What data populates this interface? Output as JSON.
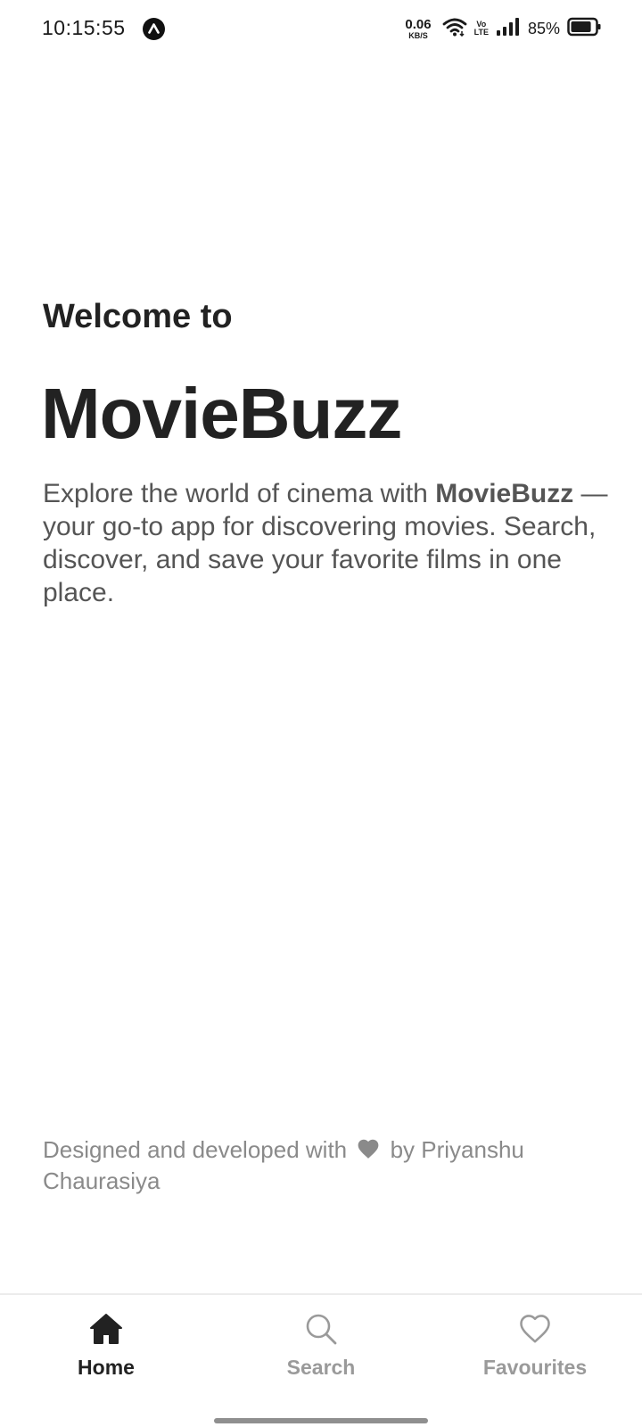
{
  "status_bar": {
    "time": "10:15:55",
    "net_speed_value": "0.06",
    "net_speed_unit": "KB/S",
    "volte_top": "Vo",
    "volte_bottom": "LTE",
    "battery_percent": "85%",
    "battery_level": 0.85,
    "icons": [
      "app-notification-icon",
      "wifi-icon",
      "volte-icon",
      "signal-icon",
      "battery-icon"
    ]
  },
  "hero": {
    "welcome": "Welcome to",
    "app_name": "MovieBuzz",
    "description_part1": "Explore the world of cinema with ",
    "description_bold": "MovieBuzz",
    "description_part2": " — your go-to app for discovering movies. Search, discover, and save your favorite films in one place."
  },
  "credit": {
    "prefix": "Designed and developed with",
    "suffix": "by Priyanshu Chaurasiya",
    "icon": "heart-icon"
  },
  "bottom_nav": {
    "active": "home",
    "items": [
      {
        "id": "home",
        "label": "Home",
        "icon": "home-icon"
      },
      {
        "id": "search",
        "label": "Search",
        "icon": "search-icon"
      },
      {
        "id": "favourites",
        "label": "Favourites",
        "icon": "heart-outline-icon"
      }
    ]
  },
  "colors": {
    "text_primary": "#222222",
    "text_secondary": "#555555",
    "text_muted": "#8a8a8a",
    "nav_inactive": "#9a9a9a"
  }
}
